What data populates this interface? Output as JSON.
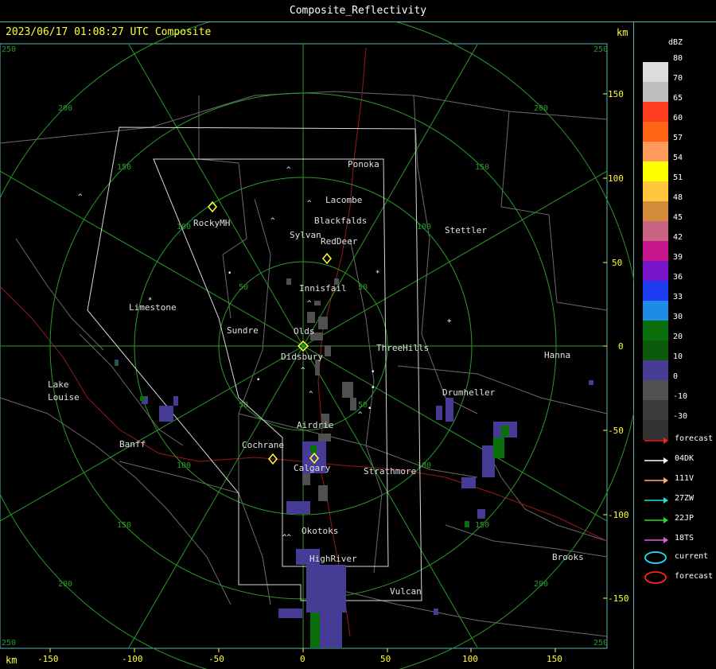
{
  "window": {
    "title": "Composite_Reflectivity"
  },
  "timestamp": "2023/06/17 01:08:27 UTC Composite",
  "units": {
    "km_top": "km",
    "km_bottom": "km"
  },
  "axis": {
    "bottom_ticks": [
      "-150",
      "-100",
      "-50",
      "0",
      "50",
      "100",
      "150"
    ],
    "right_ticks": [
      "150",
      "100",
      "50",
      "0",
      "-50",
      "-100",
      "-150"
    ],
    "ring_labels": [
      "50",
      "100",
      "150",
      "200",
      "250"
    ]
  },
  "places": {
    "ponoka": "Ponoka",
    "lacombe": "Lacombe",
    "blackfalds": "Blackfalds",
    "sylvan": "Sylvan",
    "reddeer": "RedDeer",
    "rockymh": "RockyMH",
    "stettler": "Stettler",
    "innisfail": "Innisfail",
    "limestone": "Limestone",
    "sundre": "Sundre",
    "olds": "Olds",
    "didsbury": "Didsbury",
    "threehills": "ThreeHills",
    "hanna": "Hanna",
    "lake": "Lake",
    "louise": "Louise",
    "drumheller": "Drumheller",
    "airdrie": "Airdrie",
    "banff": "Banff",
    "cochrane": "Cochrane",
    "calgary": "Calgary",
    "strathmore": "Strathmore",
    "okotoks": "Okotoks",
    "highriver": "HighRiver",
    "brooks": "Brooks",
    "vulcan": "Vulcan"
  },
  "legend": {
    "title": "dBZ",
    "scale": [
      {
        "label": "80",
        "color": "#dcdcdc"
      },
      {
        "label": "70",
        "color": "#bebebe"
      },
      {
        "label": "65",
        "color": "#ff3c1e"
      },
      {
        "label": "60",
        "color": "#ff6414"
      },
      {
        "label": "57",
        "color": "#ff9a5a"
      },
      {
        "label": "54",
        "color": "#ffff00"
      },
      {
        "label": "51",
        "color": "#ffc83c"
      },
      {
        "label": "48",
        "color": "#d28c3c"
      },
      {
        "label": "45",
        "color": "#c86482"
      },
      {
        "label": "42",
        "color": "#c8148c"
      },
      {
        "label": "39",
        "color": "#7814c8"
      },
      {
        "label": "36",
        "color": "#1e3cf0"
      },
      {
        "label": "33",
        "color": "#1e8ce6"
      },
      {
        "label": "30",
        "color": "#0a6e0a"
      },
      {
        "label": "20",
        "color": "#0a5a0a"
      },
      {
        "label": "10",
        "color": "#463c96"
      },
      {
        "label": "0",
        "color": "#505050"
      },
      {
        "label": "-10",
        "color": "#3c3c3c"
      },
      {
        "label": "-30",
        "color": "#323232"
      }
    ],
    "tracks": [
      {
        "label": "forecast",
        "color": "#ff2020"
      },
      {
        "label": "04DK",
        "color": "#ffffff"
      },
      {
        "label": "111V",
        "color": "#ffb070"
      },
      {
        "label": "27ZW",
        "color": "#20e0e0"
      },
      {
        "label": "22JP",
        "color": "#20e020"
      },
      {
        "label": "18TS",
        "color": "#e060e0"
      }
    ],
    "cells": [
      {
        "label": "current",
        "color": "#20e0ff"
      },
      {
        "label": "forecast",
        "color": "#ff2020"
      }
    ]
  }
}
